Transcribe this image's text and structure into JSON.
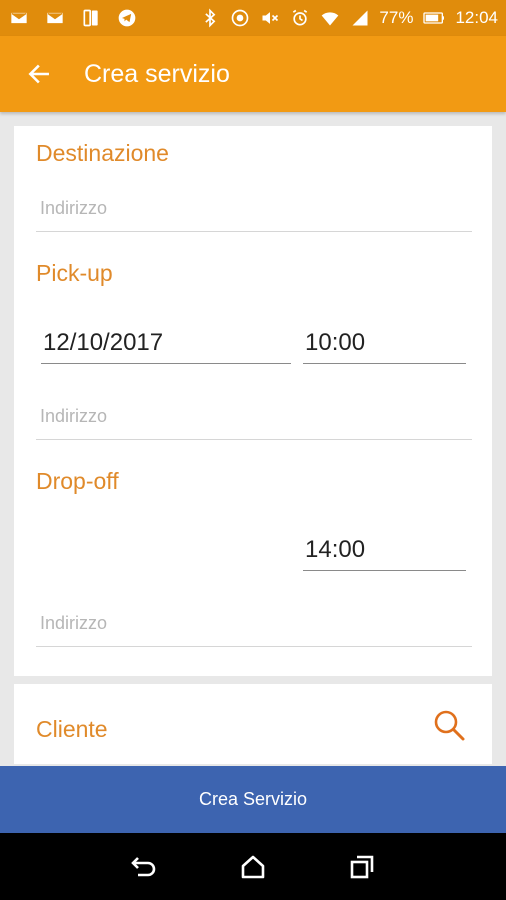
{
  "status_bar": {
    "battery": "77%",
    "time": "12:04",
    "left_icons": [
      "mail-icon",
      "mail-icon",
      "phone-icon",
      "telegram-icon"
    ],
    "right_icons": [
      "bluetooth-icon",
      "nfc-icon",
      "mute-icon",
      "alarm-icon",
      "wifi-icon",
      "signal-icon",
      "battery-icon"
    ]
  },
  "header": {
    "title": "Crea servizio",
    "back_icon": "arrow-back-icon"
  },
  "destination": {
    "title": "Destinazione",
    "address_placeholder": "Indirizzo"
  },
  "pickup": {
    "title": "Pick-up",
    "date": "12/10/2017",
    "time": "10:00",
    "address_placeholder": "Indirizzo"
  },
  "dropoff": {
    "title": "Drop-off",
    "time": "14:00",
    "address_placeholder": "Indirizzo"
  },
  "client": {
    "title": "Cliente",
    "search_icon": "search-icon"
  },
  "create_button": {
    "label": "Crea Servizio"
  },
  "nav": {
    "back": "nav-back-icon",
    "home": "nav-home-icon",
    "recents": "nav-recents-icon"
  },
  "colors": {
    "status_bar": "#e08c0c",
    "app_bar": "#f29a13",
    "accent_text": "#e08a2a",
    "primary_button": "#3d64b0",
    "background": "#e8e8e8"
  }
}
